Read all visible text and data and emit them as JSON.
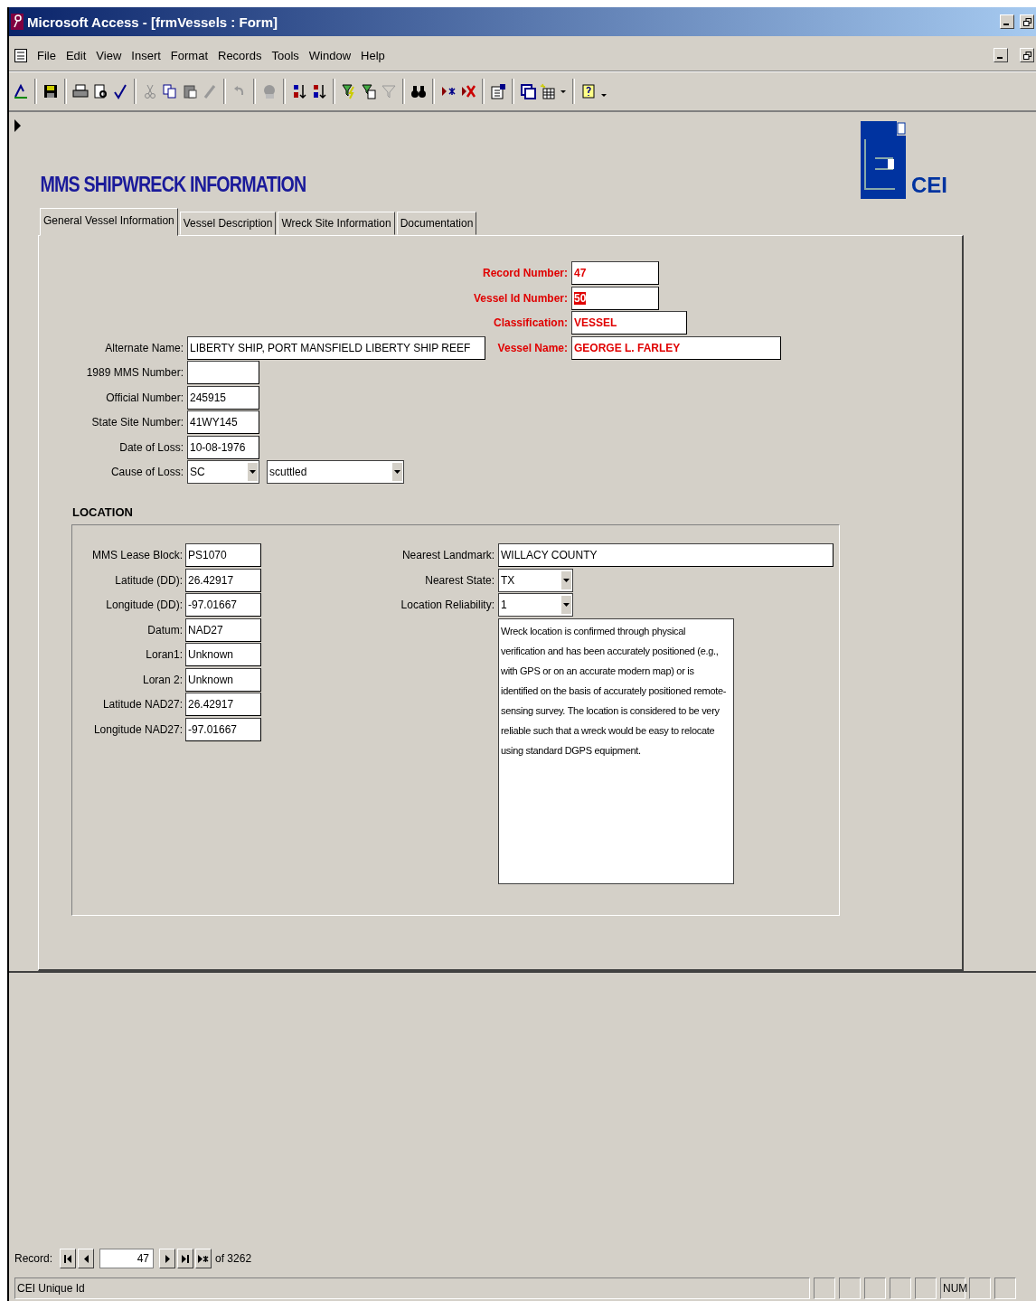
{
  "window": {
    "title": "Microsoft Access - [frmVessels : Form]"
  },
  "menu": [
    "File",
    "Edit",
    "View",
    "Insert",
    "Format",
    "Records",
    "Tools",
    "Window",
    "Help"
  ],
  "form": {
    "title": "MMS SHIPWRECK INFORMATION",
    "logo_text": "CEI",
    "tabs": [
      {
        "label": "General Vessel Information",
        "selected": true
      },
      {
        "label": "Vessel Description",
        "selected": false
      },
      {
        "label": "Wreck Site Information",
        "selected": false
      },
      {
        "label": "Documentation",
        "selected": false
      }
    ],
    "key_fields": [
      {
        "label": "Record Number:",
        "value": "47",
        "highlighted": false
      },
      {
        "label": "Vessel Id Number:",
        "value": "50",
        "highlighted": true
      },
      {
        "label": "Classification:",
        "value": "VESSEL",
        "highlighted": false
      },
      {
        "label": "Vessel Name:",
        "value": "GEORGE L. FARLEY",
        "highlighted": false
      }
    ],
    "fields": [
      {
        "label": "Alternate Name:",
        "value": "LIBERTY SHIP, PORT MANSFIELD LIBERTY SHIP REEF"
      },
      {
        "label": "1989 MMS Number:"
      },
      {
        "label": "Official Number:",
        "value": "245915"
      },
      {
        "label": "State Site Number:",
        "value": "41WY145"
      },
      {
        "label": "Date of Loss:",
        "value": "10-08-1976"
      },
      {
        "label": "Cause of Loss:",
        "value": "SC",
        "detail": "scuttled"
      }
    ],
    "location": {
      "heading": "LOCATION",
      "fields": [
        {
          "label": "MMS Lease Block:",
          "value": "PS1070"
        },
        {
          "label": "Latitude (DD):",
          "value": "26.42917"
        },
        {
          "label": "Longitude (DD):",
          "value": "-97.01667"
        },
        {
          "label": "Datum:",
          "value": "NAD27"
        },
        {
          "label": "Loran1:",
          "value": "Unknown"
        },
        {
          "label": "Loran 2:",
          "value": "Unknown"
        },
        {
          "label": "Latitude NAD27:",
          "value": "26.42917"
        },
        {
          "label": "Longitude NAD27:",
          "value": "-97.01667"
        }
      ],
      "landmark": {
        "label": "Nearest Landmark:",
        "value": "WILLACY COUNTY"
      },
      "state": {
        "label": "Nearest State:",
        "value": "TX"
      },
      "reliability": {
        "label": "Location Reliability:",
        "value": "1"
      },
      "reliability_note": "Wreck location is confirmed through physical verification and has been accurately positioned (e.g., with GPS or on an accurate modern map) or is identified on the basis of accurately positioned remote-sensing survey.  The location is considered to be very reliable such that a wreck would be easy to relocate using standard DGPS equipment."
    }
  },
  "navigator": {
    "label": "Record:",
    "current": "47",
    "total": "of  3262"
  },
  "status_bar": {
    "text": "CEI Unique Id",
    "indicator": "NUM"
  }
}
